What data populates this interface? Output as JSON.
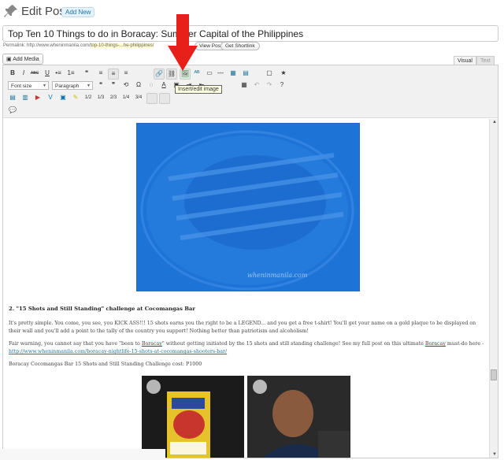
{
  "header": {
    "title": "Edit Post",
    "add_new_label": "Add New"
  },
  "post": {
    "title": "Top Ten 10 Things to do in Boracay: Summer      Capital of the Philippines",
    "permalink_label": "Permalink:",
    "permalink_url": "http://www.wheninmanila.com/",
    "permalink_slug": "top-10-things-...he-philippines/",
    "view_post_label": "View Post",
    "get_shortlink_label": "Get Shortlink"
  },
  "media": {
    "add_media_label": "Add Media"
  },
  "editor_tabs": {
    "visual": "Visual",
    "text": "Text"
  },
  "toolbar": {
    "row1": [
      "B",
      "I",
      "ABC",
      "U",
      "•≡",
      "1≡",
      "❝",
      "≡",
      "≡",
      "≡",
      "🔗",
      "⛓",
      "🖼",
      "ᴬᴮ",
      "▭",
      "—",
      "▦",
      "▤",
      "▢",
      "★"
    ],
    "font_size_label": "Font size",
    "paragraph_label": "Paragraph",
    "row2": [
      "❝",
      "❞",
      "⟲",
      "Ω",
      "◌",
      "A",
      "▣",
      "⇥",
      "⇤",
      "?"
    ],
    "row3": [
      "1/2",
      "1/3",
      "2/3",
      "1/4",
      "3/4"
    ],
    "tooltip": "Insert/edit image"
  },
  "content": {
    "image_watermark": "wheninmanila.com",
    "heading": "2. \"15 Shots and Still Standing\" challenge at Cocomangas Bar",
    "para1": "It's pretty simple. You come, you see, you KICK ASS!!! 15 shots earns you the right to be a LEGEND... and you get a free t-shirt! You'll get your name on a gold plaque to be displayed on their wall and you'll add a point to the tally of the country you support! Nothing better than patriotism and alcoholism!",
    "para2_a": "Fair warning, you cannot say that you have \"been to ",
    "para2_boracay": "Boracay",
    "para2_b": "\" without getting initiated by the 15 shots and still standing challenge! See my full post on this ultimate ",
    "para2_boracay2": "Boracay",
    "para2_c": " must-do here - ",
    "para2_link": "http://www.wheninmanila.com/boracay-nightlife-15-shots-at-cocomangas-shooters-bar/",
    "para3": "Boracay Cocomangas Bar 15 Shots and Still Standing Challenge cost: P1000"
  },
  "colors": {
    "accent_red": "#e8201a",
    "image_overlay": "#1e73d6",
    "link": "#21759b"
  }
}
